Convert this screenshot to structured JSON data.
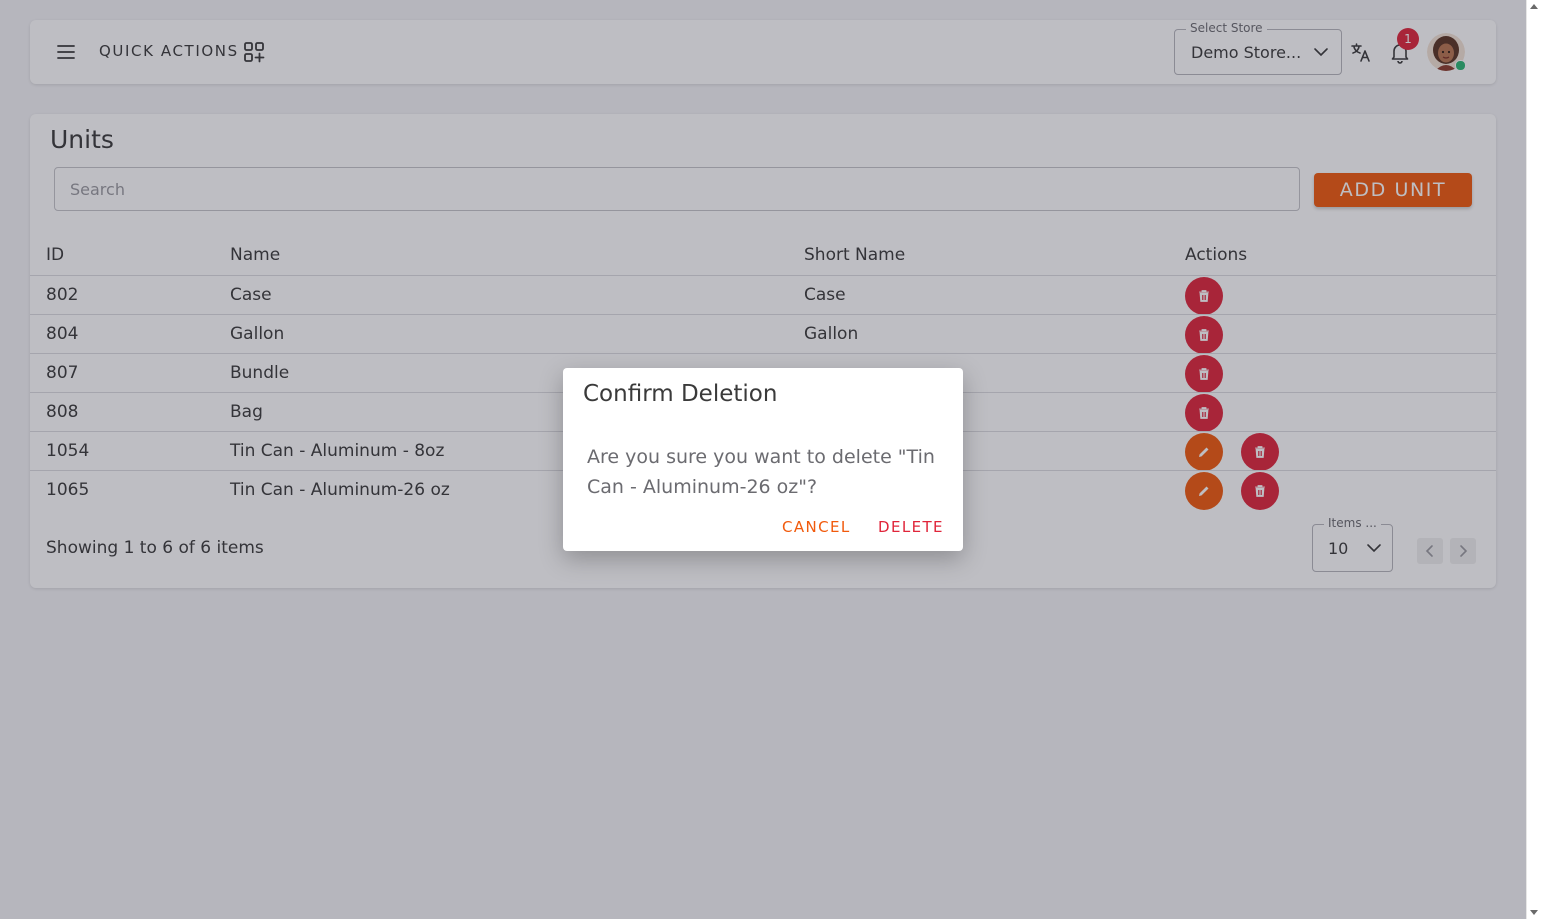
{
  "header": {
    "quick_actions_label": "QUICK ACTIONS",
    "store_select": {
      "label": "Select Store",
      "value": "Demo Store..."
    },
    "notification_count": "1"
  },
  "units": {
    "title": "Units",
    "search_placeholder": "Search",
    "add_button": "ADD UNIT",
    "columns": {
      "id": "ID",
      "name": "Name",
      "short_name": "Short Name",
      "actions": "Actions"
    },
    "rows": [
      {
        "id": "802",
        "name": "Case",
        "short_name": "Case",
        "actions": [
          "delete"
        ]
      },
      {
        "id": "804",
        "name": "Gallon",
        "short_name": "Gallon",
        "actions": [
          "delete"
        ]
      },
      {
        "id": "807",
        "name": "Bundle",
        "short_name": "",
        "actions": [
          "delete"
        ]
      },
      {
        "id": "808",
        "name": "Bag",
        "short_name": "",
        "actions": [
          "delete"
        ]
      },
      {
        "id": "1054",
        "name": "Tin Can - Aluminum - 8oz",
        "short_name": "",
        "actions": [
          "edit",
          "delete"
        ]
      },
      {
        "id": "1065",
        "name": "Tin Can - Aluminum-26 oz",
        "short_name": "",
        "actions": [
          "edit",
          "delete"
        ]
      }
    ],
    "footer_text": "Showing 1 to 6 of 6 items",
    "items_per_page": {
      "label": "Items ...",
      "value": "10"
    }
  },
  "dialog": {
    "title": "Confirm Deletion",
    "message": "Are you sure you want to delete \"Tin Can - Aluminum-26 oz\"?",
    "cancel_label": "CANCEL",
    "delete_label": "DELETE"
  },
  "colors": {
    "accent": "#f15a0c",
    "danger": "#e0253a",
    "online": "#2bb673"
  },
  "icons": [
    "menu-icon",
    "quick-actions-icon",
    "chevron-down-icon",
    "translate-icon",
    "bell-icon",
    "avatar",
    "edit-icon",
    "trash-icon",
    "chevron-left-icon",
    "chevron-right-icon"
  ]
}
